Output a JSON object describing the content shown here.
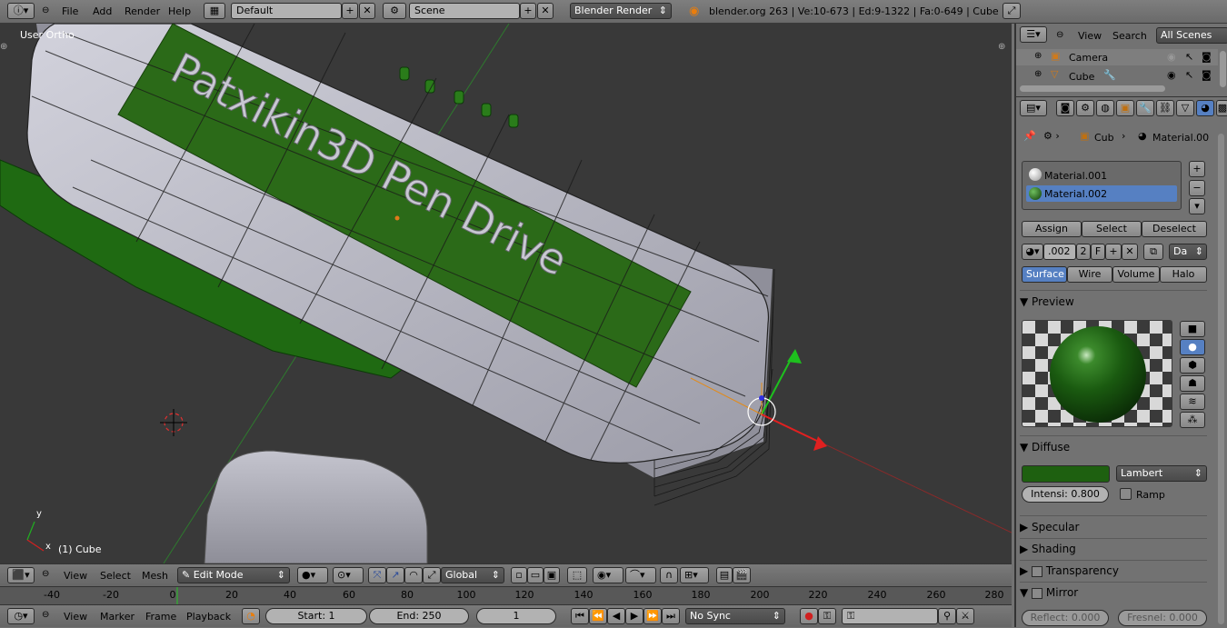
{
  "topbar": {
    "menus": [
      "File",
      "Add",
      "Render",
      "Help"
    ],
    "screen": "Default",
    "scene": "Scene",
    "engine": "Blender Render",
    "stats": "blender.org 263 | Ve:10-673 | Ed:9-1322 | Fa:0-649 | Cube"
  },
  "viewport": {
    "view_label": "User Ortho",
    "object_label": "(1) Cube",
    "model_text": "Patxikin3D Pen Drive",
    "axis_x": "x",
    "axis_y": "y"
  },
  "view_header": {
    "menus": [
      "View",
      "Select",
      "Mesh"
    ],
    "mode": "Edit Mode",
    "orientation": "Global"
  },
  "timeline": {
    "ticks": [
      "-40",
      "-20",
      "0",
      "20",
      "40",
      "60",
      "80",
      "100",
      "120",
      "140",
      "160",
      "180",
      "200",
      "220",
      "240",
      "260",
      "280"
    ],
    "menus": [
      "View",
      "Marker",
      "Frame",
      "Playback"
    ],
    "start": "Start: 1",
    "end": "End: 250",
    "current": "1",
    "sync": "No Sync"
  },
  "outliner": {
    "menus": [
      "View",
      "Search"
    ],
    "filter": "All Scenes",
    "items": [
      "Camera",
      "Cube"
    ]
  },
  "properties": {
    "breadcrumb_object": "Cub",
    "breadcrumb_material": "Material.00",
    "materials": [
      "Material.001",
      "Material.002"
    ],
    "assign": "Assign",
    "select": "Select",
    "deselect": "Deselect",
    "mat_name": ".002",
    "users": "2",
    "fake": "F",
    "data_dropdown": "Da",
    "tabs": [
      "Surface",
      "Wire",
      "Volume",
      "Halo"
    ],
    "preview_label": "Preview",
    "diffuse_label": "Diffuse",
    "diffuse_shader": "Lambert",
    "intensity": "Intensi: 0.800",
    "ramp": "Ramp",
    "specular": "Specular",
    "shading": "Shading",
    "transparency": "Transparency",
    "mirror": "Mirror",
    "reflect": "Reflect: 0.000",
    "fresnel": "Fresnel: 0.000"
  },
  "colors": {
    "accent_blue": "#5680c2",
    "diffuse_color": "#1e6010",
    "viewport_bg": "#393939"
  }
}
